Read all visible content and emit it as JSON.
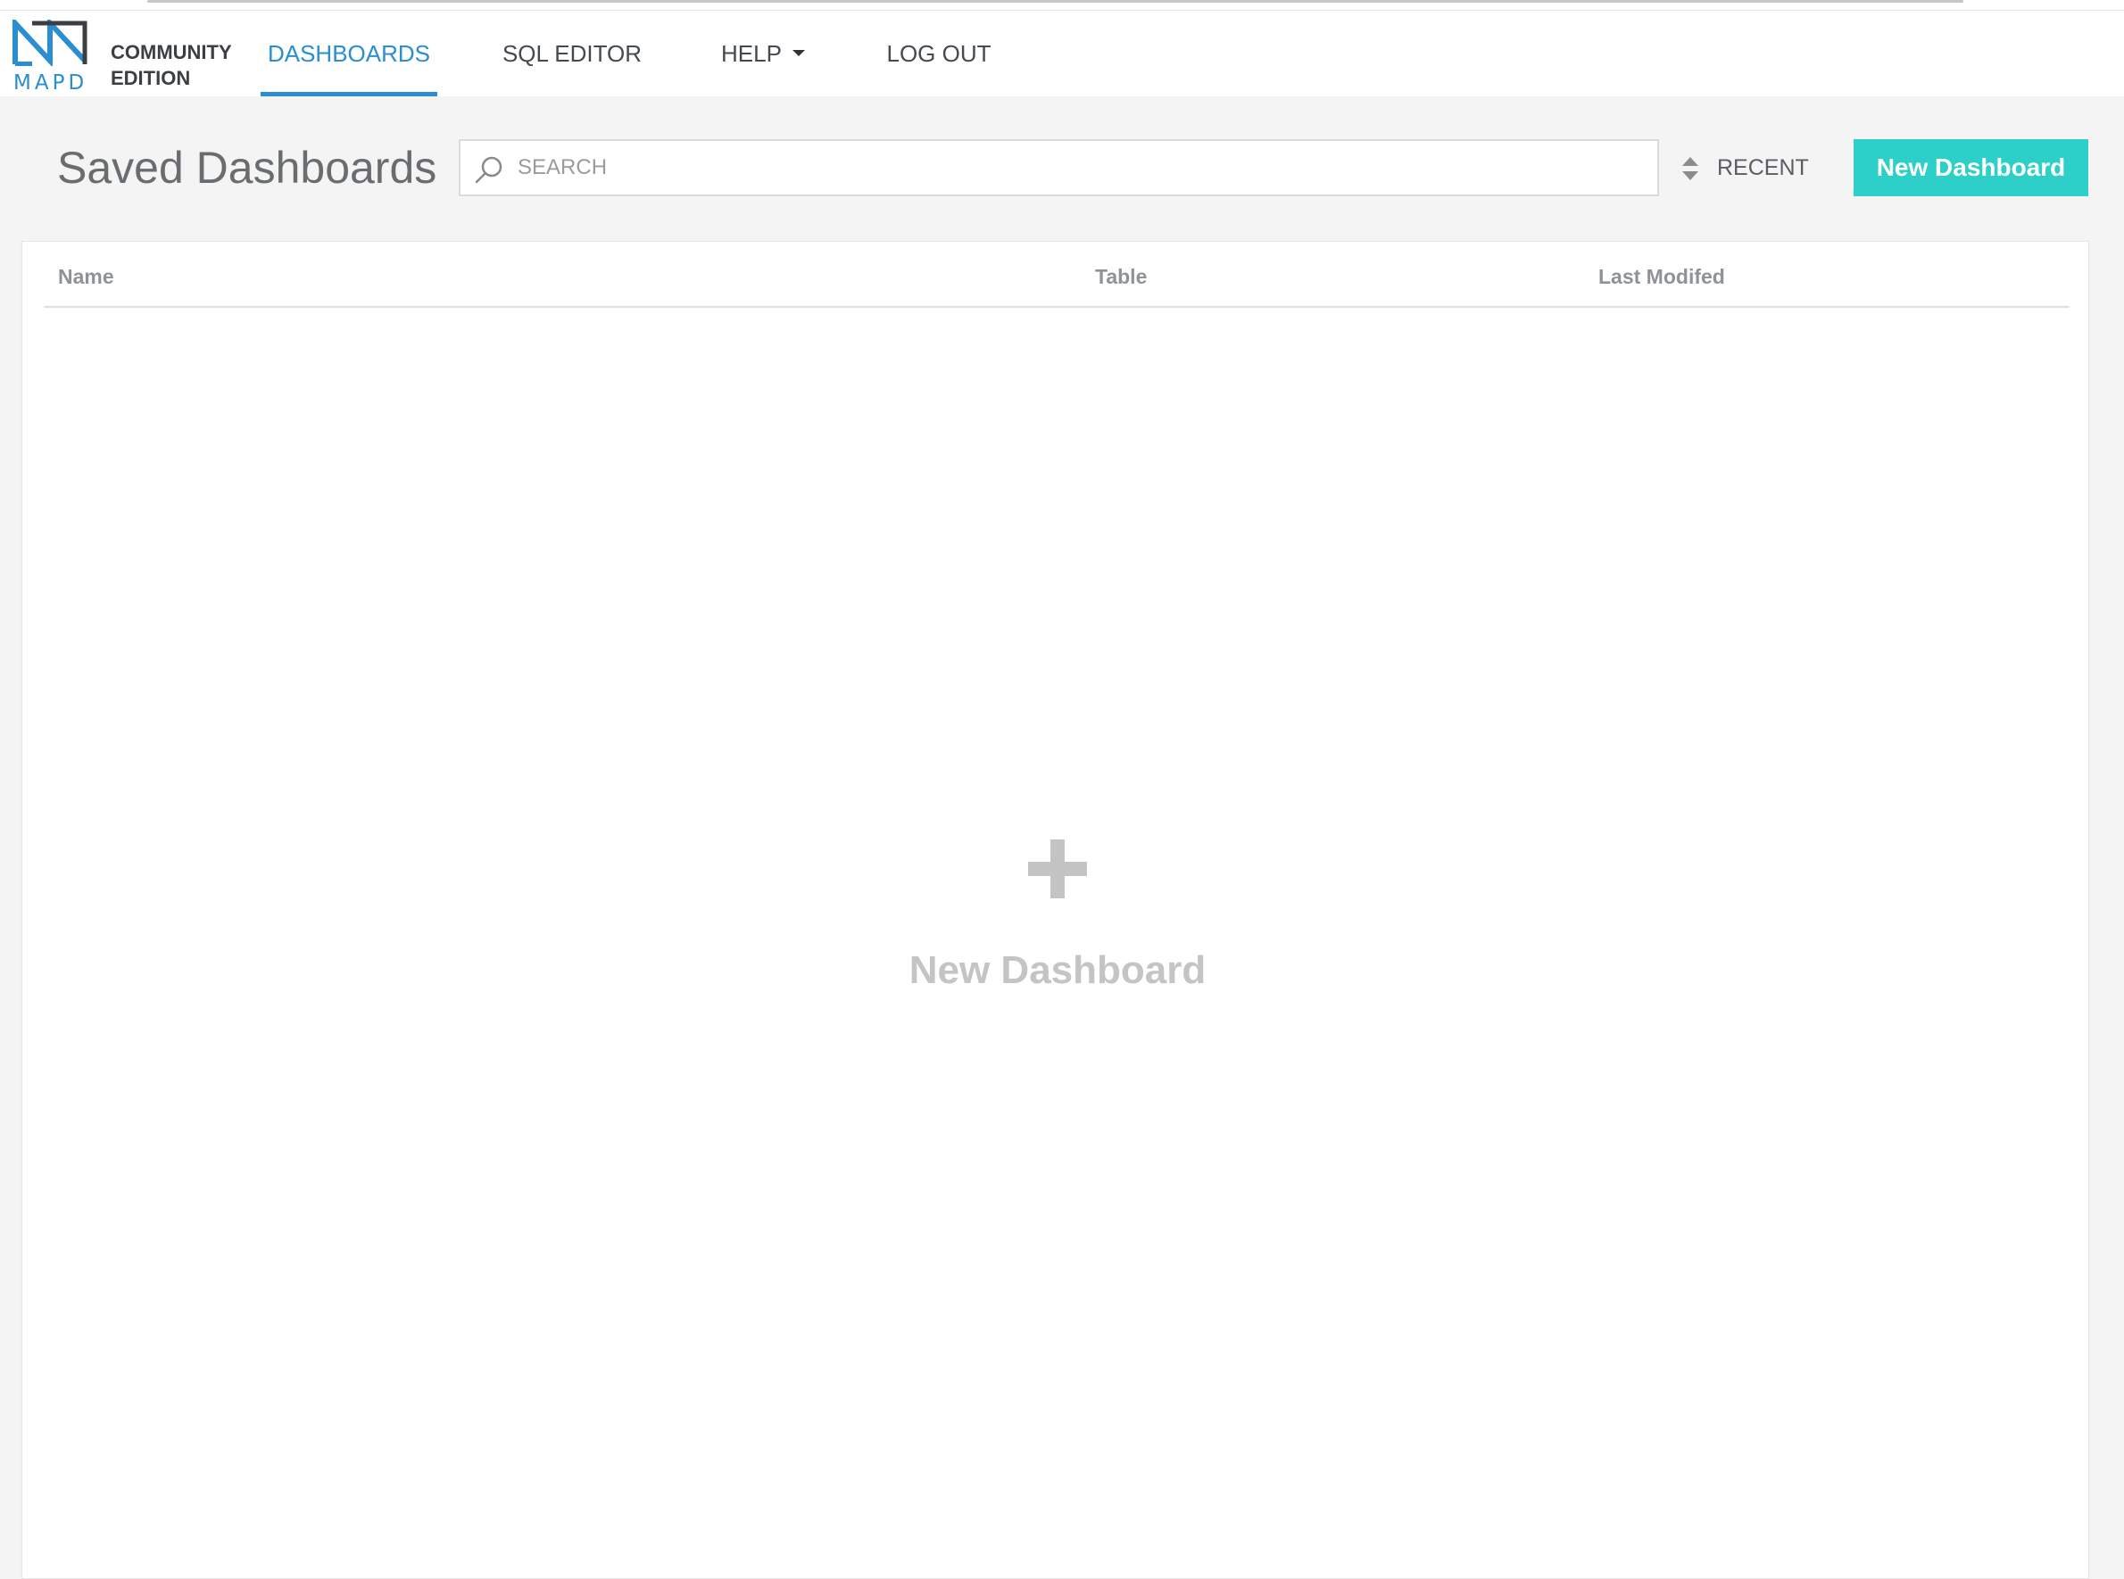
{
  "brand": {
    "logo_word": "MAPD",
    "edition_line1": "COMMUNITY",
    "edition_line2": "EDITION",
    "accent_color": "#2a8ed1"
  },
  "nav": {
    "items": [
      {
        "label": "DASHBOARDS",
        "active": true
      },
      {
        "label": "SQL EDITOR",
        "active": false
      },
      {
        "label": "HELP",
        "active": false,
        "icon": "caret-down-icon"
      },
      {
        "label": "LOG OUT",
        "active": false
      }
    ]
  },
  "toolbar": {
    "title": "Saved Dashboards",
    "search_placeholder": "SEARCH",
    "search_value": "",
    "sort_label": "RECENT",
    "sort_icon": "sort-icon",
    "new_button_label": "New Dashboard",
    "new_button_color": "#2dd0c8"
  },
  "table": {
    "columns": [
      "Name",
      "Table",
      "Last Modifed"
    ],
    "rows": []
  },
  "empty_state": {
    "icon": "plus-icon",
    "label": "New Dashboard"
  }
}
